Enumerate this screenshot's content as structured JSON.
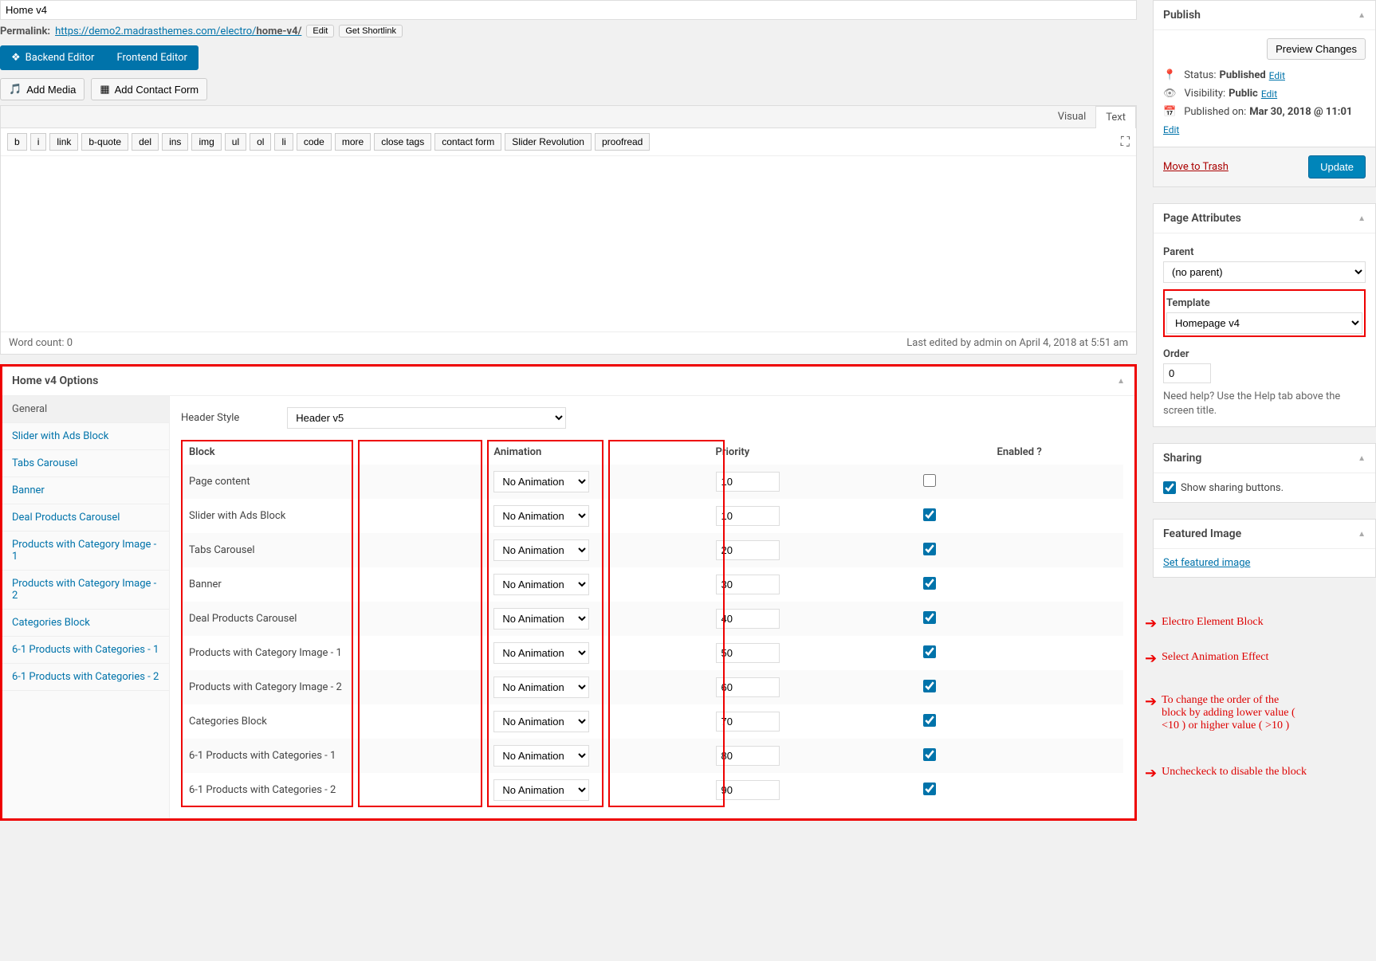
{
  "title": "Home v4",
  "permalink": {
    "label": "Permalink:",
    "base": "https://demo2.madrasthemes.com/electro/",
    "slug": "home-v4/",
    "edit": "Edit",
    "shortlink": "Get Shortlink"
  },
  "editor_tabs": {
    "backend": "Backend Editor",
    "frontend": "Frontend Editor"
  },
  "media": {
    "add": "Add Media",
    "contact": "Add Contact Form"
  },
  "editor_modes": {
    "visual": "Visual",
    "text": "Text"
  },
  "quicktags": [
    "b",
    "i",
    "link",
    "b-quote",
    "del",
    "ins",
    "img",
    "ul",
    "ol",
    "li",
    "code",
    "more",
    "close tags",
    "contact form",
    "Slider Revolution",
    "proofread"
  ],
  "status_bar": {
    "wordcount": "Word count: 0",
    "lastedit": "Last edited by admin on April 4, 2018 at 5:51 am"
  },
  "publish": {
    "title": "Publish",
    "preview": "Preview Changes",
    "status_label": "Status:",
    "status_value": "Published",
    "visibility_label": "Visibility:",
    "visibility_value": "Public",
    "published_label": "Published on:",
    "published_value": "Mar 30, 2018 @ 11:01",
    "edit": "Edit",
    "trash": "Move to Trash",
    "update": "Update"
  },
  "page_attributes": {
    "title": "Page Attributes",
    "parent_label": "Parent",
    "parent_value": "(no parent)",
    "template_label": "Template",
    "template_value": "Homepage v4",
    "order_label": "Order",
    "order_value": "0",
    "help": "Need help? Use the Help tab above the screen title."
  },
  "sharing": {
    "title": "Sharing",
    "checkbox_label": "Show sharing buttons."
  },
  "featured": {
    "title": "Featured Image",
    "link": "Set featured image"
  },
  "options_box": {
    "title": "Home v4 Options",
    "tabs": [
      "General",
      "Slider with Ads Block",
      "Tabs Carousel",
      "Banner",
      "Deal Products Carousel",
      "Products with Category Image - 1",
      "Products with Category Image - 2",
      "Categories Block",
      "6-1 Products with Categories - 1",
      "6-1 Products with Categories - 2"
    ],
    "header_style_label": "Header Style",
    "header_style_value": "Header v5",
    "table_headers": {
      "block": "Block",
      "animation": "Animation",
      "priority": "Priority",
      "enabled": "Enabled ?"
    },
    "animation_option": "No Animation",
    "rows": [
      {
        "name": "Page content",
        "priority": "10",
        "enabled": false
      },
      {
        "name": "Slider with Ads Block",
        "priority": "10",
        "enabled": true
      },
      {
        "name": "Tabs Carousel",
        "priority": "20",
        "enabled": true
      },
      {
        "name": "Banner",
        "priority": "30",
        "enabled": true
      },
      {
        "name": "Deal Products Carousel",
        "priority": "40",
        "enabled": true
      },
      {
        "name": "Products with Category Image - 1",
        "priority": "50",
        "enabled": true
      },
      {
        "name": "Products with Category Image - 2",
        "priority": "60",
        "enabled": true
      },
      {
        "name": "Categories Block",
        "priority": "70",
        "enabled": true
      },
      {
        "name": "6-1 Products with Categories - 1",
        "priority": "80",
        "enabled": true
      },
      {
        "name": "6-1 Products with Categories - 2",
        "priority": "90",
        "enabled": true
      }
    ]
  },
  "annotations": {
    "a1": "Electro Element Block",
    "a2": "Select Animation Effect",
    "a3": "To change the  order of the block  by adding lower value ( <10 ) or higher value ( >10 )",
    "a4": "Uncheckeck to disable the block"
  }
}
